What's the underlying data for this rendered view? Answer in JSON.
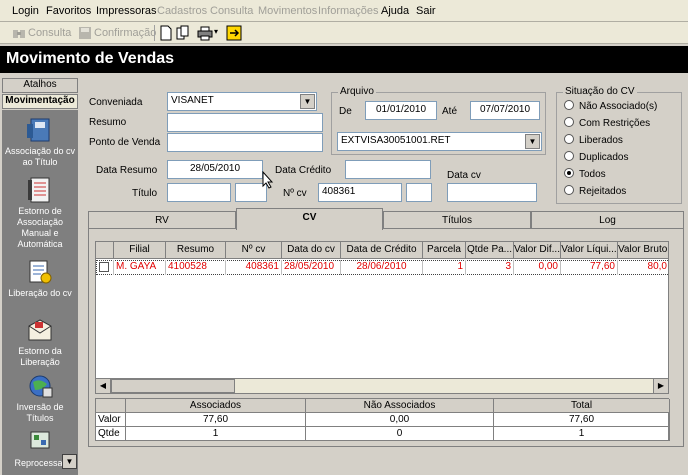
{
  "menu": {
    "items": [
      {
        "label": "Login",
        "enabled": true
      },
      {
        "label": "Favoritos",
        "enabled": true
      },
      {
        "label": "Impressoras",
        "enabled": true
      },
      {
        "label": "Cadastros",
        "enabled": false
      },
      {
        "label": "Consulta",
        "enabled": false
      },
      {
        "label": "Movimentos",
        "enabled": false
      },
      {
        "label": "Informações",
        "enabled": false
      },
      {
        "label": "Ajuda",
        "enabled": true
      },
      {
        "label": "Sair",
        "enabled": true
      }
    ]
  },
  "toolbar": {
    "consulta_label": "Consulta",
    "confirmacao_label": "Confirmação"
  },
  "window": {
    "title": "Movimento de Vendas"
  },
  "sidebar": {
    "tabs": [
      "Atalhos",
      "Movimentação"
    ],
    "items": [
      {
        "label": "Associação do cv ao Título",
        "icon": "binder-icon"
      },
      {
        "label": "Estorno de Associação Manual e Automática",
        "icon": "ledger-icon"
      },
      {
        "label": "Liberação do cv",
        "icon": "document-icon"
      },
      {
        "label": "Estorno da Liberação",
        "icon": "envelope-icon"
      },
      {
        "label": "Inversão de Títulos",
        "icon": "globe-icon"
      },
      {
        "label": "Reprocessar",
        "icon": "process-icon"
      }
    ]
  },
  "filters": {
    "conveniada_label": "Conveniada",
    "conveniada_value": "VISANET",
    "resumo_label": "Resumo",
    "resumo_value": "",
    "ponto_label": "Ponto de Venda",
    "ponto_value": "",
    "data_resumo_label": "Data Resumo",
    "data_resumo_value": "28/05/2010",
    "data_credito_label": "Data Crédito",
    "data_credito_value": "",
    "titulo_label": "Título",
    "titulo_value": "",
    "titulo_value2": "",
    "ncv_label": "Nº cv",
    "ncv_value": "408361",
    "ncv_value2": "",
    "data_cv_label": "Data cv",
    "data_cv_value": ""
  },
  "arquivo": {
    "title": "Arquivo",
    "de_label": "De",
    "de_value": "01/01/2010",
    "ate_label": "Até",
    "ate_value": "07/07/2010",
    "file_value": "EXTVISA30051001.RET"
  },
  "situacao": {
    "title": "Situação do CV",
    "options": [
      {
        "label": "Não Associado(s)",
        "selected": false
      },
      {
        "label": "Com Restrições",
        "selected": false
      },
      {
        "label": "Liberados",
        "selected": false
      },
      {
        "label": "Duplicados",
        "selected": false
      },
      {
        "label": "Todos",
        "selected": true
      },
      {
        "label": "Rejeitados",
        "selected": false
      }
    ]
  },
  "tabs": [
    {
      "label": "RV",
      "active": false
    },
    {
      "label": "CV",
      "active": true
    },
    {
      "label": "Títulos",
      "active": false
    },
    {
      "label": "Log",
      "active": false
    }
  ],
  "grid": {
    "columns": [
      "",
      "Filial",
      "Resumo",
      "Nº cv",
      "Data do cv",
      "Data de Crédito",
      "Parcela",
      "Qtde Pa...",
      "Valor Dif...",
      "Valor Líqui...",
      "Valor Bruto..."
    ],
    "rows": [
      [
        "",
        "M. GAYA",
        "4100528",
        "408361",
        "28/05/2010",
        "28/06/2010",
        "1",
        "3",
        "0,00",
        "77,60",
        "80,0"
      ]
    ],
    "row_color": "#e00000"
  },
  "totals": {
    "headers": [
      "",
      "Associados",
      "Não Associados",
      "Total"
    ],
    "rows": [
      [
        "Valor",
        "77,60",
        "0,00",
        "77,60"
      ],
      [
        "Qtde",
        "1",
        "0",
        "1"
      ]
    ]
  }
}
